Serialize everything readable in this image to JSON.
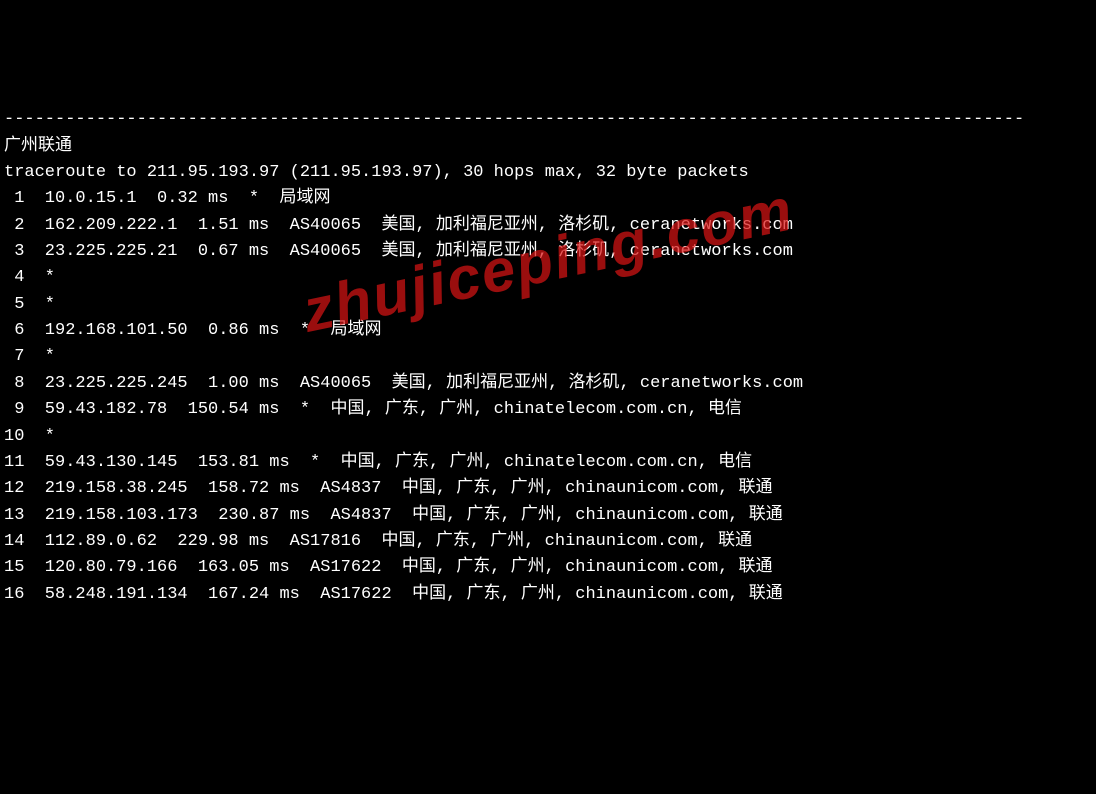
{
  "separator_line": "----------------------------------------------------------------------------------------------------",
  "title": "广州联通",
  "traceroute_header": "traceroute to 211.95.193.97 (211.95.193.97), 30 hops max, 32 byte packets",
  "watermark_text": "zhujiceping.com",
  "hops": [
    {
      "num": " 1",
      "ip": "10.0.15.1",
      "latency": "0.32 ms",
      "asn": "*",
      "location": "局域网"
    },
    {
      "num": " 2",
      "ip": "162.209.222.1",
      "latency": "1.51 ms",
      "asn": "AS40065",
      "location": "美国, 加利福尼亚州, 洛杉矶, ceranetworks.com"
    },
    {
      "num": " 3",
      "ip": "23.225.225.21",
      "latency": "0.67 ms",
      "asn": "AS40065",
      "location": "美国, 加利福尼亚州, 洛杉矶, ceranetworks.com"
    },
    {
      "num": " 4",
      "ip": "*",
      "latency": "",
      "asn": "",
      "location": ""
    },
    {
      "num": " 5",
      "ip": "*",
      "latency": "",
      "asn": "",
      "location": ""
    },
    {
      "num": " 6",
      "ip": "192.168.101.50",
      "latency": "0.86 ms",
      "asn": "*",
      "location": "局域网"
    },
    {
      "num": " 7",
      "ip": "*",
      "latency": "",
      "asn": "",
      "location": ""
    },
    {
      "num": " 8",
      "ip": "23.225.225.245",
      "latency": "1.00 ms",
      "asn": "AS40065",
      "location": "美国, 加利福尼亚州, 洛杉矶, ceranetworks.com"
    },
    {
      "num": " 9",
      "ip": "59.43.182.78",
      "latency": "150.54 ms",
      "asn": "*",
      "location": "中国, 广东, 广州, chinatelecom.com.cn, 电信"
    },
    {
      "num": "10",
      "ip": "*",
      "latency": "",
      "asn": "",
      "location": ""
    },
    {
      "num": "11",
      "ip": "59.43.130.145",
      "latency": "153.81 ms",
      "asn": "*",
      "location": "中国, 广东, 广州, chinatelecom.com.cn, 电信"
    },
    {
      "num": "12",
      "ip": "219.158.38.245",
      "latency": "158.72 ms",
      "asn": "AS4837",
      "location": "中国, 广东, 广州, chinaunicom.com, 联通"
    },
    {
      "num": "13",
      "ip": "219.158.103.173",
      "latency": "230.87 ms",
      "asn": "AS4837",
      "location": "中国, 广东, 广州, chinaunicom.com, 联通"
    },
    {
      "num": "14",
      "ip": "112.89.0.62",
      "latency": "229.98 ms",
      "asn": "AS17816",
      "location": "中国, 广东, 广州, chinaunicom.com, 联通"
    },
    {
      "num": "15",
      "ip": "120.80.79.166",
      "latency": "163.05 ms",
      "asn": "AS17622",
      "location": "中国, 广东, 广州, chinaunicom.com, 联通"
    },
    {
      "num": "16",
      "ip": "58.248.191.134",
      "latency": "167.24 ms",
      "asn": "AS17622",
      "location": "中国, 广东, 广州, chinaunicom.com, 联通"
    }
  ]
}
